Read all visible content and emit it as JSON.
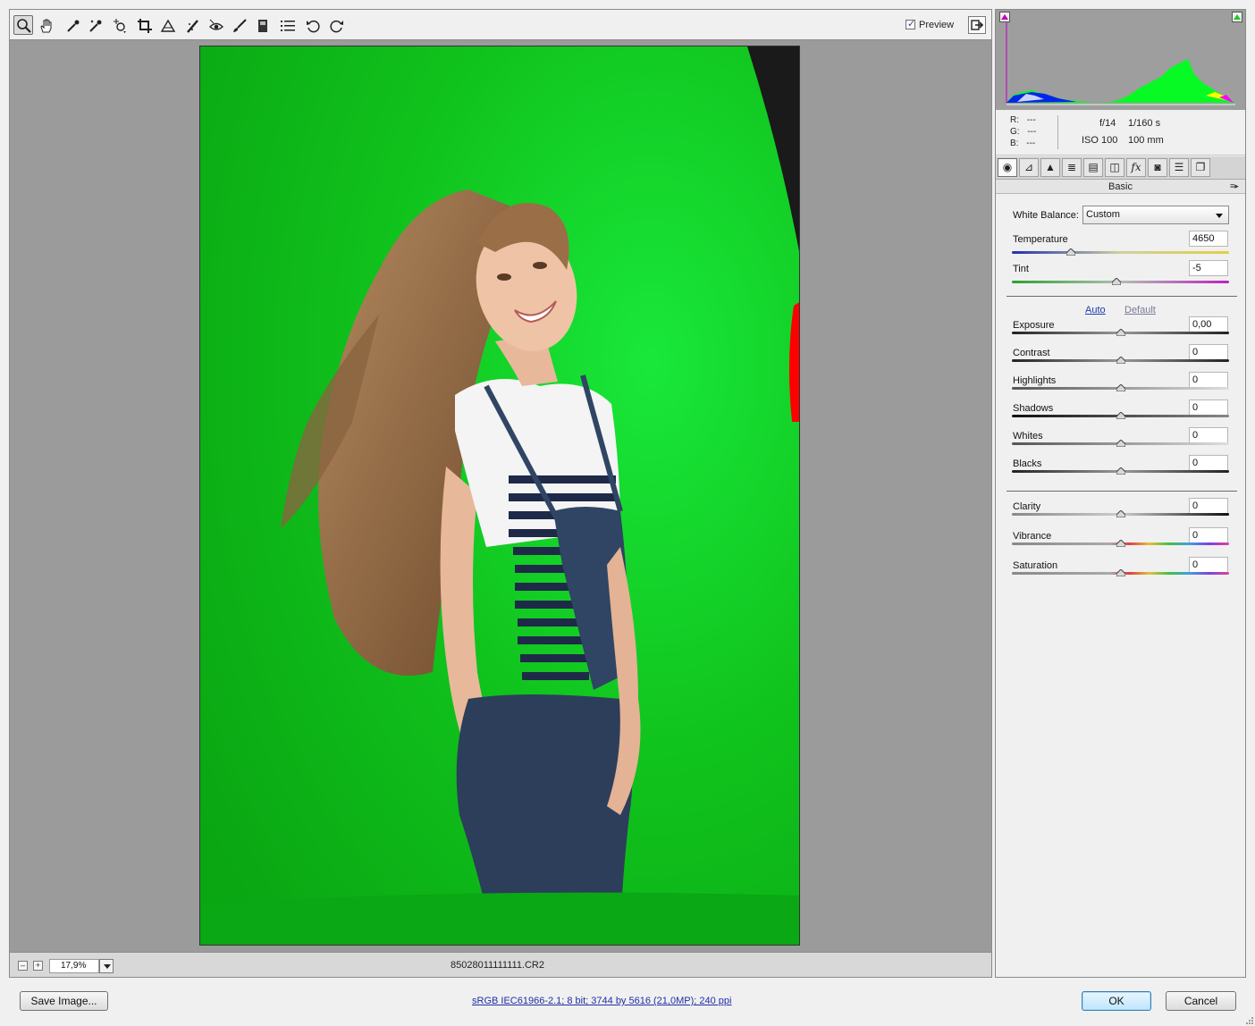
{
  "toolbar": {
    "tools": [
      {
        "name": "zoom-tool",
        "icon": "magnifier-icon"
      },
      {
        "name": "hand-tool",
        "icon": "hand-icon"
      },
      {
        "name": "white-balance-tool",
        "icon": "eyedropper-icon"
      },
      {
        "name": "color-sampler-tool",
        "icon": "sampler-icon"
      },
      {
        "name": "target-adjustment-tool",
        "icon": "target-icon"
      },
      {
        "name": "crop-tool",
        "icon": "crop-icon"
      },
      {
        "name": "straighten-tool",
        "icon": "straighten-icon"
      },
      {
        "name": "spot-removal-tool",
        "icon": "spot-removal-icon"
      },
      {
        "name": "red-eye-tool",
        "icon": "red-eye-icon"
      },
      {
        "name": "adjustment-brush-tool",
        "icon": "brush-icon"
      },
      {
        "name": "graduated-filter-tool",
        "icon": "gradient-icon"
      },
      {
        "name": "preferences-button",
        "icon": "list-icon"
      },
      {
        "name": "rotate-left-button",
        "icon": "rotate-ccw-icon"
      },
      {
        "name": "rotate-right-button",
        "icon": "rotate-cw-icon"
      }
    ],
    "preview_label": "Preview",
    "preview_checked": true
  },
  "status": {
    "zoom": "17,9%",
    "filename": "85028011111111.CR2"
  },
  "readout": {
    "r_label": "R:",
    "r_value": "---",
    "g_label": "G:",
    "g_value": "---",
    "b_label": "B:",
    "b_value": "---",
    "aperture": "f/14",
    "shutter": "1/160 s",
    "iso": "ISO 100",
    "focal": "100 mm"
  },
  "panel": {
    "tab_icons": [
      "aperture-icon",
      "tone-curve-icon",
      "detail-icon",
      "hsl-icon",
      "split-toning-icon",
      "lens-icon",
      "fx-icon",
      "camera-calibration-icon",
      "presets-icon",
      "snapshots-icon"
    ],
    "section_title": "Basic",
    "white_balance_label": "White Balance:",
    "white_balance_value": "Custom",
    "temperature_label": "Temperature",
    "temperature_value": "4650",
    "tint_label": "Tint",
    "tint_value": "-5",
    "auto_label": "Auto",
    "default_label": "Default",
    "sliders": [
      {
        "label": "Exposure",
        "value": "0,00",
        "level": 0.5
      },
      {
        "label": "Contrast",
        "value": "0",
        "level": 0.5
      },
      {
        "label": "Highlights",
        "value": "0",
        "level": 0.5
      },
      {
        "label": "Shadows",
        "value": "0",
        "level": 0.5
      },
      {
        "label": "Whites",
        "value": "0",
        "level": 0.5
      },
      {
        "label": "Blacks",
        "value": "0",
        "level": 0.5
      }
    ],
    "presence": [
      {
        "label": "Clarity",
        "value": "0",
        "level": 0.5
      },
      {
        "label": "Vibrance",
        "value": "0",
        "level": 0.5
      },
      {
        "label": "Saturation",
        "value": "0",
        "level": 0.5
      }
    ],
    "temperature_level": 0.27,
    "tint_level": 0.48
  },
  "footer": {
    "save_label": "Save Image...",
    "info_link": "sRGB IEC61966-2.1; 8 bit; 3744 by 5616 (21,0MP); 240 ppi",
    "ok_label": "OK",
    "cancel_label": "Cancel"
  },
  "colors": {
    "backdrop_green": "#0fc01a",
    "highlight_warning": "#ff0000",
    "accent_blue": "#1c3fb0"
  }
}
